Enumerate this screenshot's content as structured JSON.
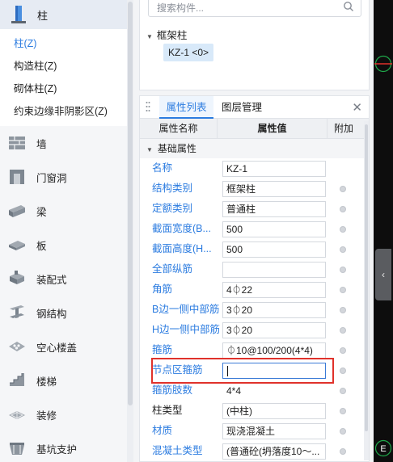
{
  "left_nav": {
    "current": {
      "label": "柱",
      "icon": "column-icon"
    },
    "sub_items": [
      {
        "label": "柱(Z)",
        "active": true
      },
      {
        "label": "构造柱(Z)",
        "active": false
      },
      {
        "label": "砌体柱(Z)",
        "active": false
      },
      {
        "label": "约束边缘非阴影区(Z)",
        "active": false
      }
    ],
    "items": [
      {
        "label": "墙",
        "icon": "wall-icon"
      },
      {
        "label": "门窗洞",
        "icon": "door-window-icon"
      },
      {
        "label": "梁",
        "icon": "beam-icon"
      },
      {
        "label": "板",
        "icon": "slab-icon"
      },
      {
        "label": "装配式",
        "icon": "prefab-icon"
      },
      {
        "label": "钢结构",
        "icon": "steel-structure-icon"
      },
      {
        "label": "空心楼盖",
        "icon": "hollow-floor-icon"
      },
      {
        "label": "楼梯",
        "icon": "stairs-icon"
      },
      {
        "label": "装修",
        "icon": "decoration-icon"
      },
      {
        "label": "基坑支护",
        "icon": "foundation-pit-icon"
      }
    ]
  },
  "component_tree": {
    "search_placeholder": "搜索构件...",
    "group_label": "框架柱",
    "selected_item": "KZ-1 <0>"
  },
  "properties_panel": {
    "tabs": [
      "属性列表",
      "图层管理"
    ],
    "active_tab": 0,
    "columns": {
      "name": "属性名称",
      "value": "属性值",
      "extra": "附加"
    },
    "section": "基础属性",
    "rows": [
      {
        "name": "名称",
        "value": "KZ-1",
        "linked": true,
        "dot": false,
        "boxed": true
      },
      {
        "name": "结构类别",
        "value": "框架柱",
        "linked": true,
        "dot": true,
        "boxed": true
      },
      {
        "name": "定额类别",
        "value": "普通柱",
        "linked": true,
        "dot": true,
        "boxed": true
      },
      {
        "name": "截面宽度(B...",
        "value": "500",
        "linked": true,
        "dot": true,
        "boxed": true
      },
      {
        "name": "截面高度(H...",
        "value": "500",
        "linked": true,
        "dot": true,
        "boxed": true
      },
      {
        "name": "全部纵筋",
        "value": "",
        "linked": true,
        "dot": true,
        "boxed": true
      },
      {
        "name": "角筋",
        "value": "4⏀22",
        "linked": true,
        "dot": true,
        "boxed": true
      },
      {
        "name": "B边一侧中部筋",
        "value": "3⏀20",
        "linked": true,
        "dot": true,
        "boxed": true
      },
      {
        "name": "H边一侧中部筋",
        "value": "3⏀20",
        "linked": true,
        "dot": true,
        "boxed": true
      },
      {
        "name": "箍筋",
        "value": "⏀10@100/200(4*4)",
        "linked": true,
        "dot": true,
        "boxed": true
      },
      {
        "name": "节点区箍筋",
        "value": "",
        "linked": true,
        "dot": true,
        "boxed": true,
        "editing": true
      },
      {
        "name": "箍筋肢数",
        "value": "4*4",
        "linked": true,
        "dot": true,
        "boxed": false
      },
      {
        "name": "柱类型",
        "value": "(中柱)",
        "linked": false,
        "dot": true,
        "boxed": true
      },
      {
        "name": "材质",
        "value": "现浇混凝土",
        "linked": true,
        "dot": true,
        "boxed": true
      },
      {
        "name": "混凝土类型",
        "value": "(普通砼(坍落度10～...",
        "linked": true,
        "dot": true,
        "boxed": true
      }
    ],
    "highlight_color": "#e0322b"
  },
  "viewport": {
    "compass_top_label": "",
    "compass_bottom_label": "E",
    "collapse_glyph": "‹"
  },
  "colors": {
    "accent": "#2c7ce0",
    "highlight": "#e0322b",
    "compass": "#1fa84a"
  }
}
